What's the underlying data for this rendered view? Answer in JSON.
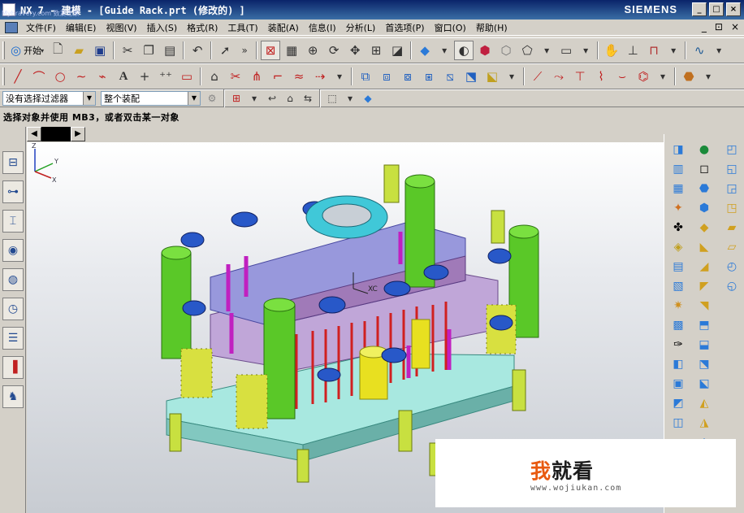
{
  "window": {
    "title": "NX 7 - 建模 - [Guide Rack.prt  (修改的)  ]",
    "watermark": "Mybravery.com 数友之家",
    "brand": "SIEMENS",
    "controls": [
      "_",
      "□",
      "×"
    ]
  },
  "menubar": {
    "items": [
      "文件(F)",
      "编辑(E)",
      "视图(V)",
      "插入(S)",
      "格式(R)",
      "工具(T)",
      "装配(A)",
      "信息(I)",
      "分析(L)",
      "首选项(P)",
      "窗口(O)",
      "帮助(H)"
    ],
    "right_controls": [
      "_",
      "⊡",
      "×"
    ]
  },
  "toolbar": {
    "start_label": "开始",
    "start_arrow": "▾",
    "overflow": "»"
  },
  "filters": {
    "selection_filter": "没有选择过滤器",
    "scope": "整个装配"
  },
  "cue": {
    "text": "选择对象并使用 MB3，或者双击某一对象"
  },
  "viewport": {
    "triad": {
      "z": "Z",
      "y": "Y",
      "x": "X"
    },
    "wcs_label": "XC"
  },
  "logo": {
    "text_first": "我",
    "text_rest": "就看",
    "url": "www.wojiukan.com"
  },
  "colors": {
    "titlebar": "#0a246a",
    "chrome": "#d4d0c8",
    "plate_violet": "#a0a0d8",
    "plate_purple": "#9a7ab0",
    "plate_cyan": "#a8e8e0",
    "pillar_green": "#55c020",
    "spring_yellow": "#d8e040",
    "screw_blue": "#2858c8",
    "ring_cyan": "#40c8d8"
  }
}
